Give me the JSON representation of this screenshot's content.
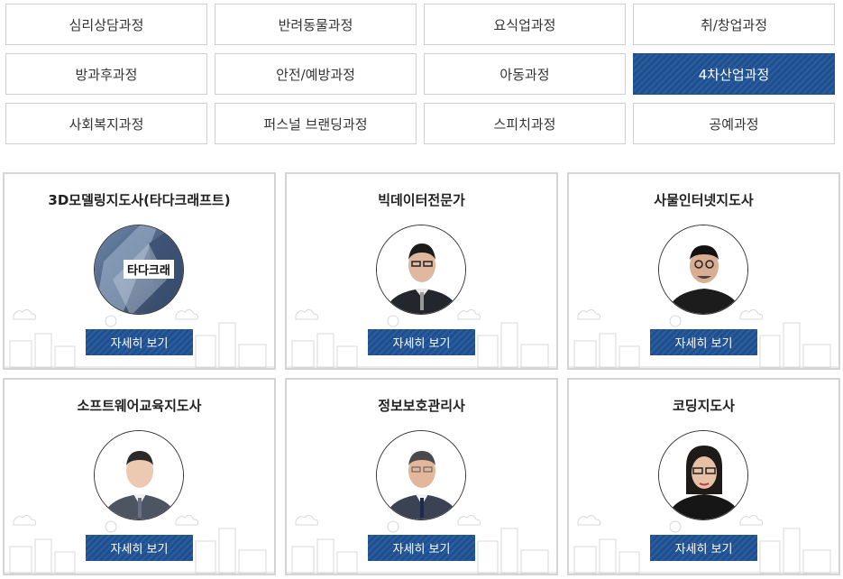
{
  "categories": [
    {
      "label": "심리상담과정",
      "active": false
    },
    {
      "label": "반려동물과정",
      "active": false
    },
    {
      "label": "요식업과정",
      "active": false
    },
    {
      "label": "취/창업과정",
      "active": false
    },
    {
      "label": "방과후과정",
      "active": false
    },
    {
      "label": "안전/예방과정",
      "active": false
    },
    {
      "label": "아동과정",
      "active": false
    },
    {
      "label": "4차산업과정",
      "active": true
    },
    {
      "label": "사회복지과정",
      "active": false
    },
    {
      "label": "퍼스널 브랜딩과정",
      "active": false
    },
    {
      "label": "스피치과정",
      "active": false
    },
    {
      "label": "공예과정",
      "active": false
    }
  ],
  "courses": [
    {
      "title": "3D모델링지도사(타다크래프트)",
      "image_tag": "타다크래",
      "button": "자세히 보기"
    },
    {
      "title": "빅데이터전문가",
      "button": "자세히 보기"
    },
    {
      "title": "사물인터넷지도사",
      "button": "자세히 보기"
    },
    {
      "title": "소프트웨어교육지도사",
      "button": "자세히 보기"
    },
    {
      "title": "정보보호관리사",
      "button": "자세히 보기"
    },
    {
      "title": "코딩지도사",
      "button": "자세히 보기"
    }
  ],
  "colors": {
    "accent": "#1f4f8f",
    "border": "#d4d4d4"
  }
}
